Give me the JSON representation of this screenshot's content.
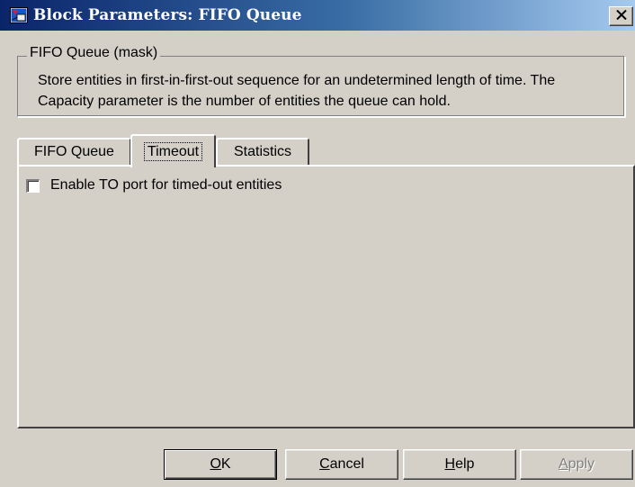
{
  "window": {
    "title": "Block Parameters: FIFO Queue",
    "icon": "simulink-block-icon",
    "close_icon": "close-icon"
  },
  "group": {
    "legend": "FIFO Queue (mask)",
    "description": "Store entities in first-in-first-out sequence for an undetermined length of time. The Capacity parameter is the number of entities the queue can hold."
  },
  "tabs": [
    {
      "label": "FIFO Queue",
      "active": false
    },
    {
      "label": "Timeout",
      "active": true
    },
    {
      "label": "Statistics",
      "active": false
    }
  ],
  "timeout_tab": {
    "enable_to_port": {
      "label": "Enable TO port for timed-out entities",
      "checked": false
    }
  },
  "buttons": {
    "ok": {
      "mnemonic": "O",
      "rest": "K"
    },
    "cancel": {
      "mnemonic": "C",
      "rest": "ancel"
    },
    "help": {
      "mnemonic": "H",
      "rest": "elp"
    },
    "apply": {
      "mnemonic": "A",
      "rest": "pply",
      "disabled": true
    }
  },
  "colors": {
    "dialog_bg": "#d4d0c8",
    "title_start": "#0a246a",
    "title_end": "#a6caf0",
    "disabled_text": "#808080"
  }
}
